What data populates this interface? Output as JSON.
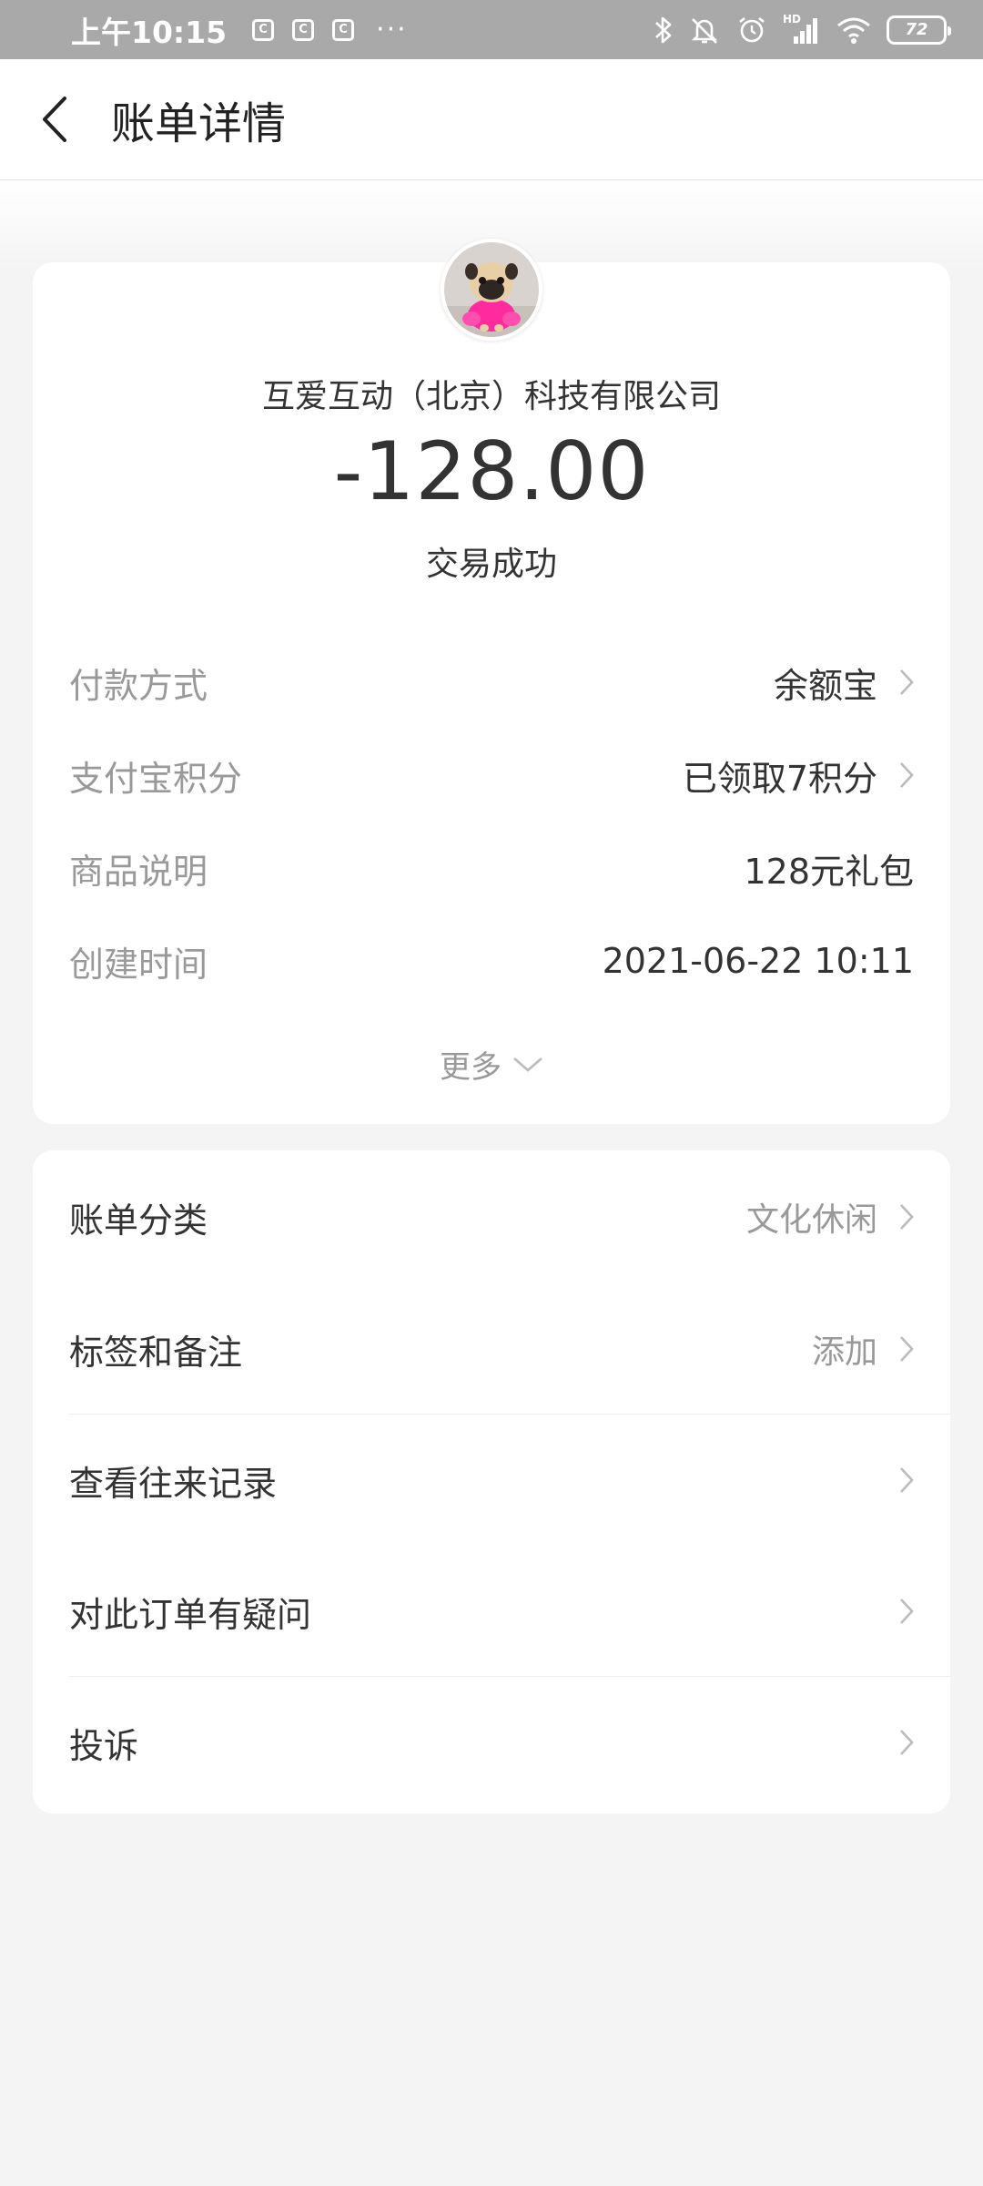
{
  "status_bar": {
    "time": "上午10:15",
    "notifications": [
      "C",
      "C",
      "C"
    ],
    "more": "···",
    "signal_label": "HD",
    "battery": "72",
    "icons": [
      "bluetooth-icon",
      "mute-icon",
      "alarm-icon",
      "signal-icon",
      "wifi-icon",
      "battery-icon"
    ]
  },
  "header": {
    "title": "账单详情",
    "back_icon": "chevron-left-icon"
  },
  "summary": {
    "merchant": "互爱互动（北京）科技有限公司",
    "amount": "-128.00",
    "status": "交易成功",
    "details": [
      {
        "label": "付款方式",
        "value": "余额宝",
        "chevron": true
      },
      {
        "label": "支付宝积分",
        "value": "已领取7积分",
        "chevron": true
      },
      {
        "label": "商品说明",
        "value": "128元礼包",
        "chevron": false
      },
      {
        "label": "创建时间",
        "value": "2021-06-22 10:11",
        "chevron": false
      }
    ],
    "more": "更多"
  },
  "actions": [
    {
      "label": "账单分类",
      "value": "文化休闲"
    },
    {
      "label": "标签和备注",
      "value": "添加"
    },
    {
      "label": "查看往来记录",
      "value": ""
    },
    {
      "label": "对此订单有疑问",
      "value": ""
    },
    {
      "label": "投诉",
      "value": ""
    }
  ],
  "colors": {
    "status_bar_bg": "#a9a9a9",
    "page_bg": "#f4f4f4",
    "card_bg": "#ffffff",
    "primary_text": "#333333",
    "secondary_text": "#999999",
    "avatar_accent": "#ff2a9e"
  }
}
